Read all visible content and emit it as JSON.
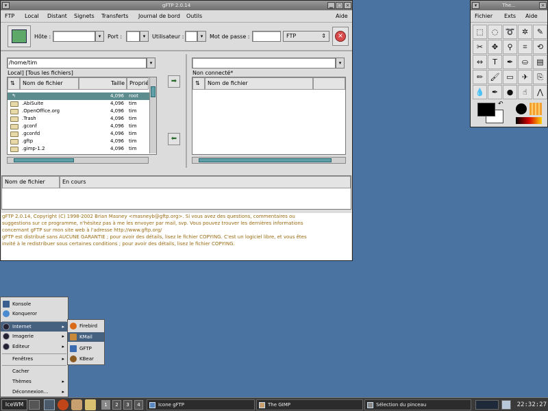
{
  "gftp": {
    "title": "gFTP 2.0.14",
    "menu": [
      "FTP",
      "Local",
      "Distant",
      "Signets",
      "Transferts",
      "Journal de bord",
      "Outils"
    ],
    "menu_help": "Aide",
    "host_label": "Hôte :",
    "port_label": "Port :",
    "user_label": "Utilisateur :",
    "pass_label": "Mot de passe :",
    "protocol": "FTP",
    "local_path": "/home/tim",
    "local_status": "Local] [Tous les fichiers]",
    "remote_status": "Non connecté*",
    "col_name": "Nom de fichier",
    "col_size": "Taille",
    "col_owner": "Propriét",
    "files": [
      {
        "name": "..",
        "size": "4,096",
        "owner": "root"
      },
      {
        "name": ".AbiSuite",
        "size": "4,096",
        "owner": "tim"
      },
      {
        "name": ".OpenOffice.org",
        "size": "4,096",
        "owner": "tim"
      },
      {
        "name": ".Trash",
        "size": "4,096",
        "owner": "tim"
      },
      {
        "name": ".gconf",
        "size": "4,096",
        "owner": "tim"
      },
      {
        "name": ".gconfd",
        "size": "4,096",
        "owner": "tim"
      },
      {
        "name": ".gftp",
        "size": "4,096",
        "owner": "tim"
      },
      {
        "name": ".gimp-1.2",
        "size": "4,096",
        "owner": "tim"
      }
    ],
    "queue_col_name": "Nom de fichier",
    "queue_col_progress": "En cours",
    "log": [
      "gFTP 2.0.14, Copyright (C) 1998-2002 Brian Masney <masneyb@gftp.org>. Si vous avez des questions, commentaires ou",
      "suggestions sur ce programme, n'hésitez pas à me les envoyer par mail, svp. Vous pouvez trouver les dernières informations",
      "concernant gFTP sur mon site web à l'adresse http://www.gftp.org/",
      "gFTP est distribué sans AUCUNE GARANTIE ; pour avoir des détails, lisez le fichier COPYING. C'est un logiciel libre, et vous êtes",
      "invité à le redistribuer sous certaines conditions ; pour avoir des détails, lisez le fichier COPYING."
    ]
  },
  "gimp": {
    "title": "The...",
    "menu": [
      "Fichier",
      "Exts",
      "Aide"
    ],
    "tools": [
      "rect-select-icon",
      "ellipse-select-icon",
      "lasso-icon",
      "magic-wand-icon",
      "bezier-icon",
      "scissors-icon",
      "move-icon",
      "zoom-icon",
      "crop-icon",
      "transform-icon",
      "flip-icon",
      "text-icon",
      "color-picker-icon",
      "bucket-fill-icon",
      "gradient-icon",
      "pencil-icon",
      "paintbrush-icon",
      "eraser-icon",
      "airbrush-icon",
      "clone-icon",
      "convolve-icon",
      "ink-icon",
      "dodge-icon",
      "smudge-icon",
      "measure-icon"
    ],
    "tool_glyphs": [
      "⬚",
      "◌",
      "➰",
      "✲",
      "✎",
      "✂",
      "✥",
      "⚲",
      "⌗",
      "⟲",
      "⇔",
      "T",
      "✒",
      "⛀",
      "▤",
      "✏",
      "🖌",
      "▭",
      "✈",
      "⎘",
      "💧",
      "✒",
      "●",
      "☝",
      "⋀"
    ],
    "fg_color": "#000000",
    "bg_color": "#ffffff"
  },
  "startmenu": {
    "top": [
      {
        "label": "Konsole"
      },
      {
        "label": "Konqueror"
      }
    ],
    "groups": [
      {
        "label": "Internet"
      },
      {
        "label": "Imagerie"
      },
      {
        "label": "Editeur"
      }
    ],
    "submenus": [
      {
        "label": "Fenêtres"
      }
    ],
    "bottom": [
      {
        "label": "Cacher"
      },
      {
        "label": "Thèmes"
      },
      {
        "label": "Déconnexion..."
      }
    ],
    "internet": [
      {
        "label": "Firebird"
      },
      {
        "label": "KMail"
      },
      {
        "label": "GFTP"
      },
      {
        "label": "KBear"
      }
    ]
  },
  "taskbar": {
    "start": "IceWM",
    "workspaces": [
      "1",
      "2",
      "3",
      "4"
    ],
    "tasks": [
      "Icone gFTP",
      "The GIMP",
      "Sélection du pinceau"
    ],
    "clock": "22:32:27"
  }
}
